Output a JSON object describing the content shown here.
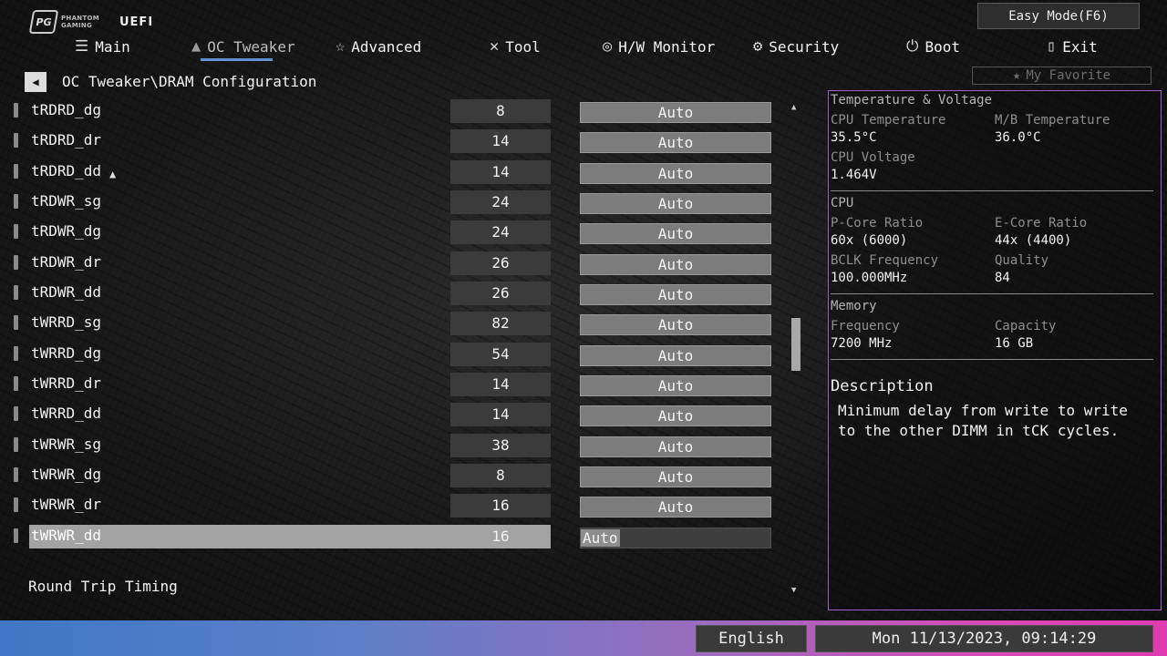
{
  "header": {
    "brand_mark": "PG",
    "brand_name": "PHANTOM GAMING",
    "uefi_label": "UEFI",
    "easy_mode_label": "Easy Mode(F6)",
    "favorite_label": "My Favorite"
  },
  "nav": {
    "items": [
      {
        "label": "Main",
        "icon": "list-icon"
      },
      {
        "label": "OC Tweaker",
        "icon": "rocket-icon",
        "active": true
      },
      {
        "label": "Advanced",
        "icon": "star-icon"
      },
      {
        "label": "Tool",
        "icon": "wrench-icon"
      },
      {
        "label": "H/W Monitor",
        "icon": "monitor-gauge-icon"
      },
      {
        "label": "Security",
        "icon": "shield-gear-icon"
      },
      {
        "label": "Boot",
        "icon": "power-icon"
      },
      {
        "label": "Exit",
        "icon": "exit-door-icon"
      }
    ]
  },
  "breadcrumb": "OC Tweaker\\DRAM Configuration",
  "settings": [
    {
      "label": "tRDRD_dg",
      "value": "8",
      "mode": "Auto"
    },
    {
      "label": "tRDRD_dr",
      "value": "14",
      "mode": "Auto"
    },
    {
      "label": "tRDRD_dd",
      "value": "14",
      "mode": "Auto"
    },
    {
      "label": "tRDWR_sg",
      "value": "24",
      "mode": "Auto"
    },
    {
      "label": "tRDWR_dg",
      "value": "24",
      "mode": "Auto"
    },
    {
      "label": "tRDWR_dr",
      "value": "26",
      "mode": "Auto"
    },
    {
      "label": "tRDWR_dd",
      "value": "26",
      "mode": "Auto"
    },
    {
      "label": "tWRRD_sg",
      "value": "82",
      "mode": "Auto"
    },
    {
      "label": "tWRRD_dg",
      "value": "54",
      "mode": "Auto"
    },
    {
      "label": "tWRRD_dr",
      "value": "14",
      "mode": "Auto"
    },
    {
      "label": "tWRRD_dd",
      "value": "14",
      "mode": "Auto"
    },
    {
      "label": "tWRWR_sg",
      "value": "38",
      "mode": "Auto"
    },
    {
      "label": "tWRWR_dg",
      "value": "8",
      "mode": "Auto"
    },
    {
      "label": "tWRWR_dr",
      "value": "16",
      "mode": "Auto"
    },
    {
      "label": "tWRWR_dd",
      "value": "16",
      "mode": "Auto",
      "selected": true
    }
  ],
  "round_trip_label": "Round Trip Timing",
  "panel": {
    "temp_voltage": {
      "title": "Temperature & Voltage",
      "cpu_temp_label": "CPU Temperature",
      "cpu_temp_value": "35.5°C",
      "mb_temp_label": "M/B Temperature",
      "mb_temp_value": "36.0°C",
      "cpu_voltage_label": "CPU Voltage",
      "cpu_voltage_value": "1.464V"
    },
    "cpu": {
      "title": "CPU",
      "pcore_label": "P-Core Ratio",
      "pcore_value": "60x (6000)",
      "ecore_label": "E-Core Ratio",
      "ecore_value": "44x (4400)",
      "bclk_label": "BCLK Frequency",
      "bclk_value": "100.000MHz",
      "quality_label": "Quality",
      "quality_value": "84"
    },
    "memory": {
      "title": "Memory",
      "freq_label": "Frequency",
      "freq_value": "7200 MHz",
      "capacity_label": "Capacity",
      "capacity_value": "16 GB"
    },
    "description": {
      "title": "Description",
      "text": "Minimum delay from write to write to the other DIMM in tCK cycles."
    }
  },
  "footer": {
    "language": "English",
    "datetime": "Mon 11/13/2023, 09:14:29"
  },
  "colors": {
    "panel_border": "#9a62c4",
    "nav_active_underline": "#5f8fd4",
    "footer_gradient_start": "#3e78c6",
    "footer_gradient_end": "#e03bb1",
    "selected_row": "#a3a3a3"
  }
}
